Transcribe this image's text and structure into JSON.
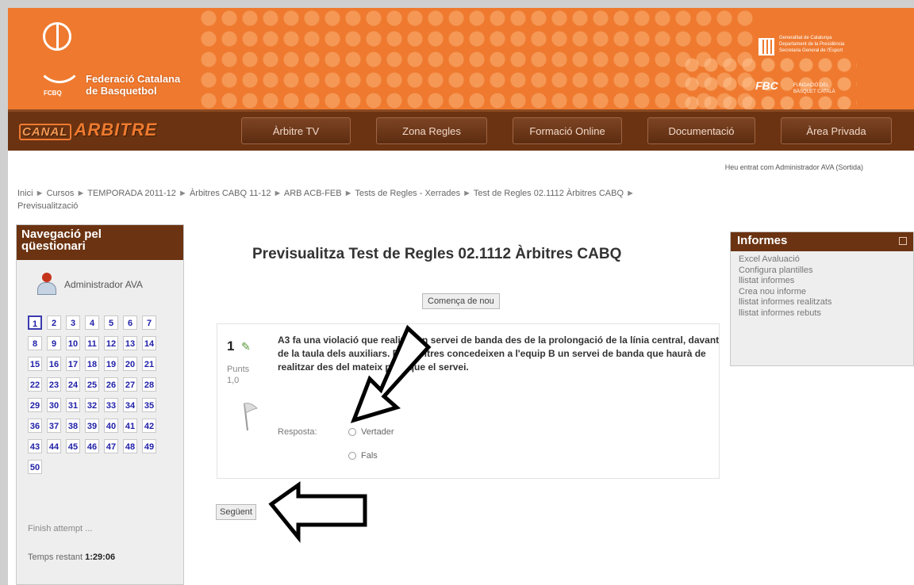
{
  "header": {
    "org_logo_abbr": "FCBQ",
    "org_name_line1": "Federació Catalana",
    "org_name_line2": "de Basquetbol",
    "gov_text_line1": "Generalitat de Catalunya",
    "gov_text_line2": "Departament de la Presidència",
    "gov_text_line3": "Secretaria General de l'Esport",
    "fbc_logo": "FBC",
    "fbc_sub_line1": "FUNDACIÓ DEL",
    "fbc_sub_line2": "BÀSQUET CATALÀ"
  },
  "nav": {
    "brand_prefix": "CANAL",
    "brand_main": "ARBITRE",
    "items": [
      "Àrbitre TV",
      "Zona Regles",
      "Formació Online",
      "Documentació",
      "Àrea Privada"
    ]
  },
  "login_info": "Heu entrat com Administrador AVA (Sortida)",
  "breadcrumb": {
    "items": [
      "Inici",
      "Cursos",
      "TEMPORADA 2011-12",
      "Àrbitres CABQ 11-12",
      "ARB ACB-FEB",
      "Tests de Regles - Xerrades",
      "Test de Regles 02.1112 Àrbitres CABQ",
      "Previsualització"
    ],
    "separator": "►"
  },
  "quiz_nav": {
    "title_line1": "Navegació pel",
    "title_line2": "qüestionari",
    "user_name": "Administrador AVA",
    "questions": [
      "1",
      "2",
      "3",
      "4",
      "5",
      "6",
      "7",
      "8",
      "9",
      "10",
      "11",
      "12",
      "13",
      "14",
      "15",
      "16",
      "17",
      "18",
      "19",
      "20",
      "21",
      "22",
      "23",
      "24",
      "25",
      "26",
      "27",
      "28",
      "29",
      "30",
      "31",
      "32",
      "33",
      "34",
      "35",
      "36",
      "37",
      "38",
      "39",
      "40",
      "41",
      "42",
      "43",
      "44",
      "45",
      "46",
      "47",
      "48",
      "49",
      "50"
    ],
    "current_question": "1",
    "finish_attempt": "Finish attempt ...",
    "timer_label": "Temps restant",
    "timer_value": "1:29:06"
  },
  "main": {
    "title": "Previsualitza Test de Regles 02.1112 Àrbitres CABQ",
    "restart_button": "Comença de nou",
    "question_number": "1",
    "points_label": "Punts",
    "points_value": "1,0",
    "question_text": "A3 fa una violació que realitza un servei de banda des de la prolongació de la línia central, davant de la taula dels auxiliars. Els àrbitres concedeixen a l'equip B un servei de banda que haurà de realitzar des del mateix punt que el servei.",
    "answer_label": "Resposta:",
    "options": [
      "Vertader",
      "Fals"
    ],
    "next_button": "Següent"
  },
  "reports": {
    "title": "Informes",
    "links": [
      "Excel Avaluació",
      "Configura plantilles",
      "llistat informes",
      "Crea nou informe",
      "llistat informes realitzats",
      "llistat informes rebuts"
    ]
  },
  "colors": {
    "banner": "#ef7a2f",
    "nav": "#6b3311",
    "question_link": "#2020a8"
  }
}
